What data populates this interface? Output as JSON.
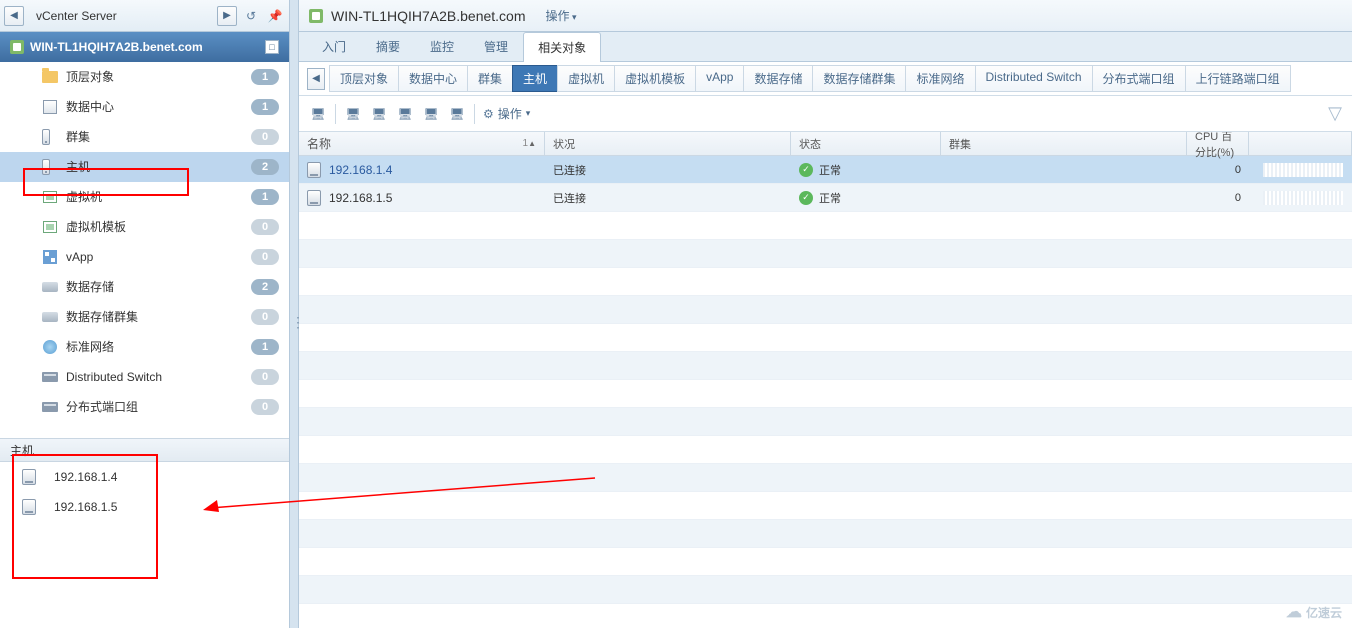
{
  "breadcrumb": "vCenter Server",
  "hostTitle": "WIN-TL1HQIH7A2B.benet.com",
  "tree": [
    {
      "label": "顶层对象",
      "count": "1",
      "icon": "folder"
    },
    {
      "label": "数据中心",
      "count": "1",
      "icon": "dc"
    },
    {
      "label": "群集",
      "count": "0",
      "icon": "host"
    },
    {
      "label": "主机",
      "count": "2",
      "icon": "host",
      "selected": true
    },
    {
      "label": "虚拟机",
      "count": "1",
      "icon": "vm"
    },
    {
      "label": "虚拟机模板",
      "count": "0",
      "icon": "vm"
    },
    {
      "label": "vApp",
      "count": "0",
      "icon": "vapp"
    },
    {
      "label": "数据存储",
      "count": "2",
      "icon": "ds"
    },
    {
      "label": "数据存储群集",
      "count": "0",
      "icon": "ds"
    },
    {
      "label": "标准网络",
      "count": "1",
      "icon": "net"
    },
    {
      "label": "Distributed Switch",
      "count": "0",
      "icon": "sw"
    },
    {
      "label": "分布式端口组",
      "count": "0",
      "icon": "sw"
    }
  ],
  "bottomTitle": "主机",
  "bottomItems": [
    "192.168.1.4",
    "192.168.1.5"
  ],
  "mainTitle": "WIN-TL1HQIH7A2B.benet.com",
  "actionsLabel": "操作",
  "tabs1": [
    "入门",
    "摘要",
    "监控",
    "管理",
    "相关对象"
  ],
  "tabs1Active": 4,
  "subtabs": [
    "顶层对象",
    "数据中心",
    "群集",
    "主机",
    "虚拟机",
    "虚拟机模板",
    "vApp",
    "数据存储",
    "数据存储群集",
    "标准网络",
    "Distributed Switch",
    "分布式端口组",
    "上行链路端口组"
  ],
  "subtabActive": 3,
  "toolbarActions": "操作",
  "columns": {
    "name": "名称",
    "status": "状况",
    "state": "状态",
    "cluster": "群集",
    "cpu": "CPU 百分比(%)"
  },
  "sortIndex": "1",
  "rows": [
    {
      "name": "192.168.1.4",
      "status": "已连接",
      "state": "正常",
      "cluster": "",
      "cpu": "0",
      "selected": true
    },
    {
      "name": "192.168.1.5",
      "status": "已连接",
      "state": "正常",
      "cluster": "",
      "cpu": "0"
    }
  ],
  "watermark": "亿速云"
}
